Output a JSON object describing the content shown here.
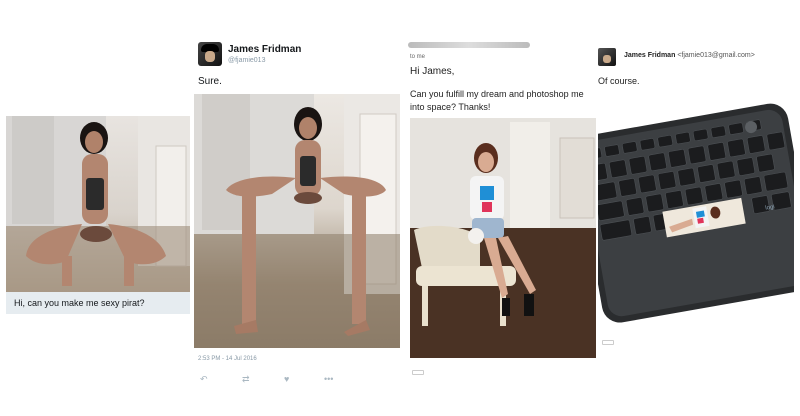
{
  "panel1": {
    "caption": "Hi, can you make me sexy pirat?"
  },
  "panel2": {
    "name": "James Fridman",
    "handle": "@fjamie013",
    "reply": "Sure.",
    "timestamp": "2:53 PM - 14 Jul 2016",
    "icons": [
      "reply-icon",
      "retweet-icon",
      "like-icon",
      "more-icon"
    ]
  },
  "panel3": {
    "to": "to me",
    "greeting": "Hi James,",
    "request": "Can you fulfill my dream and photoshop me into space? Thanks!"
  },
  "panel4": {
    "name": "James Fridman",
    "email": "<fjamie013@gmail.com>",
    "reply": "Of course."
  }
}
